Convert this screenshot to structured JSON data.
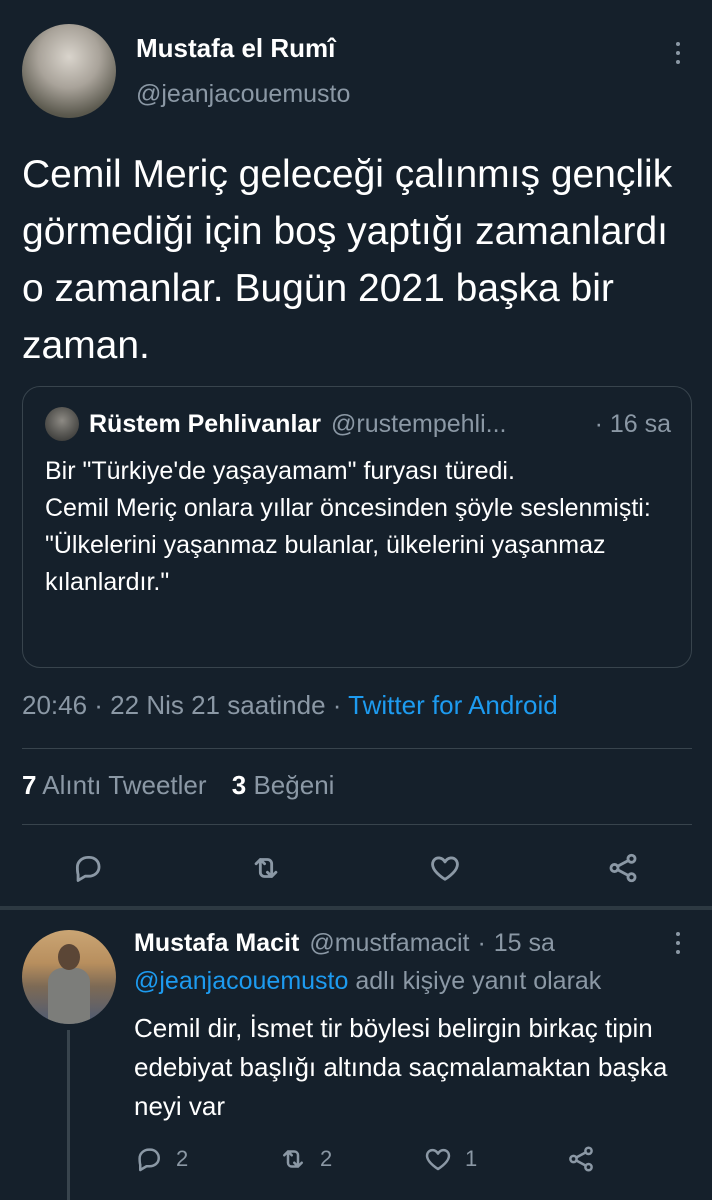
{
  "tweet": {
    "author_name": "Mustafa el Rumî",
    "author_handle": "@jeanjacouemusto",
    "text": "Cemil Meriç geleceği çalınmış gençlik görmediği için boş yaptığı zamanlardı o zamanlar. Bugün 2021 başka bir zaman.",
    "timestamp": "20:46 · 22 Nis 21 saatinde · ",
    "source": "Twitter for Android",
    "stats": {
      "quote_count": "7",
      "quote_label": "Alıntı Tweetler",
      "like_count": "3",
      "like_label": "Beğeni"
    }
  },
  "quoted_tweet": {
    "author_name": "Rüstem Pehlivanlar",
    "author_handle": "@rustempehli...",
    "time": "· 16 sa",
    "text": "Bir \"Türkiye'de yaşayamam\" furyası türedi.\nCemil Meriç onlara yıllar öncesinden şöyle seslenmişti:\n\"Ülkelerini yaşanmaz bulanlar, ülkelerini yaşanmaz kılanlardır.\""
  },
  "reply": {
    "author_name": "Mustafa Macit",
    "author_handle": "@mustfamacit",
    "time": "15 sa",
    "replying_to_mention": "@jeanjacouemusto",
    "replying_to_suffix": " adlı kişiye yanıt olarak",
    "text": "Cemil dir, İsmet tir böylesi belirgin birkaç tipin edebiyat başlığı altında saçmalamaktan başka neyi var",
    "reply_count": "2",
    "retweet_count": "2",
    "like_count": "1"
  },
  "icons": [
    "more-icon",
    "reply-icon",
    "retweet-icon",
    "like-icon",
    "share-icon"
  ],
  "colors": {
    "background": "#15202b",
    "accent": "#1d9bf0",
    "muted": "#8b98a5",
    "border": "#38444d"
  }
}
